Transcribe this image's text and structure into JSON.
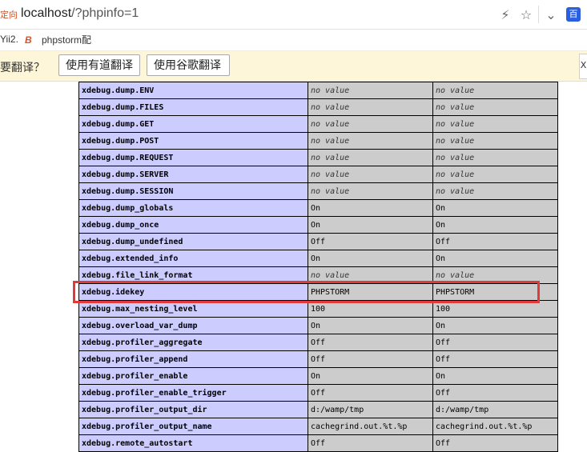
{
  "address_bar": {
    "prefix": "定向",
    "host": "localhost",
    "path": "/?phpinfo=1",
    "baidu": "百"
  },
  "bookmarks": [
    {
      "label": "Yii2."
    },
    {
      "label": "phpstorm配"
    }
  ],
  "translate_bar": {
    "prompt": "要翻译？",
    "youdao_button": "使用有道翻译",
    "google_button": "使用谷歌翻译",
    "close": "X"
  },
  "directives": [
    {
      "name": "xdebug.dump.ENV",
      "local": "no value",
      "master": "no value"
    },
    {
      "name": "xdebug.dump.FILES",
      "local": "no value",
      "master": "no value"
    },
    {
      "name": "xdebug.dump.GET",
      "local": "no value",
      "master": "no value"
    },
    {
      "name": "xdebug.dump.POST",
      "local": "no value",
      "master": "no value"
    },
    {
      "name": "xdebug.dump.REQUEST",
      "local": "no value",
      "master": "no value"
    },
    {
      "name": "xdebug.dump.SERVER",
      "local": "no value",
      "master": "no value"
    },
    {
      "name": "xdebug.dump.SESSION",
      "local": "no value",
      "master": "no value"
    },
    {
      "name": "xdebug.dump_globals",
      "local": "On",
      "master": "On"
    },
    {
      "name": "xdebug.dump_once",
      "local": "On",
      "master": "On"
    },
    {
      "name": "xdebug.dump_undefined",
      "local": "Off",
      "master": "Off"
    },
    {
      "name": "xdebug.extended_info",
      "local": "On",
      "master": "On"
    },
    {
      "name": "xdebug.file_link_format",
      "local": "no value",
      "master": "no value"
    },
    {
      "name": "xdebug.idekey",
      "local": "PHPSTORM",
      "master": "PHPSTORM"
    },
    {
      "name": "xdebug.max_nesting_level",
      "local": "100",
      "master": "100"
    },
    {
      "name": "xdebug.overload_var_dump",
      "local": "On",
      "master": "On"
    },
    {
      "name": "xdebug.profiler_aggregate",
      "local": "Off",
      "master": "Off"
    },
    {
      "name": "xdebug.profiler_append",
      "local": "Off",
      "master": "Off"
    },
    {
      "name": "xdebug.profiler_enable",
      "local": "On",
      "master": "On"
    },
    {
      "name": "xdebug.profiler_enable_trigger",
      "local": "Off",
      "master": "Off"
    },
    {
      "name": "xdebug.profiler_output_dir",
      "local": "d:/wamp/tmp",
      "master": "d:/wamp/tmp"
    },
    {
      "name": "xdebug.profiler_output_name",
      "local": "cachegrind.out.%t.%p",
      "master": "cachegrind.out.%t.%p"
    },
    {
      "name": "xdebug.remote_autostart",
      "local": "Off",
      "master": "Off"
    }
  ],
  "highlighted_row": "xdebug.idekey",
  "colors": {
    "directive_cell": "#ccccff",
    "value_cell": "#cccccc",
    "highlight": "#e03a3a",
    "translate_bar": "#fdf6d8"
  }
}
